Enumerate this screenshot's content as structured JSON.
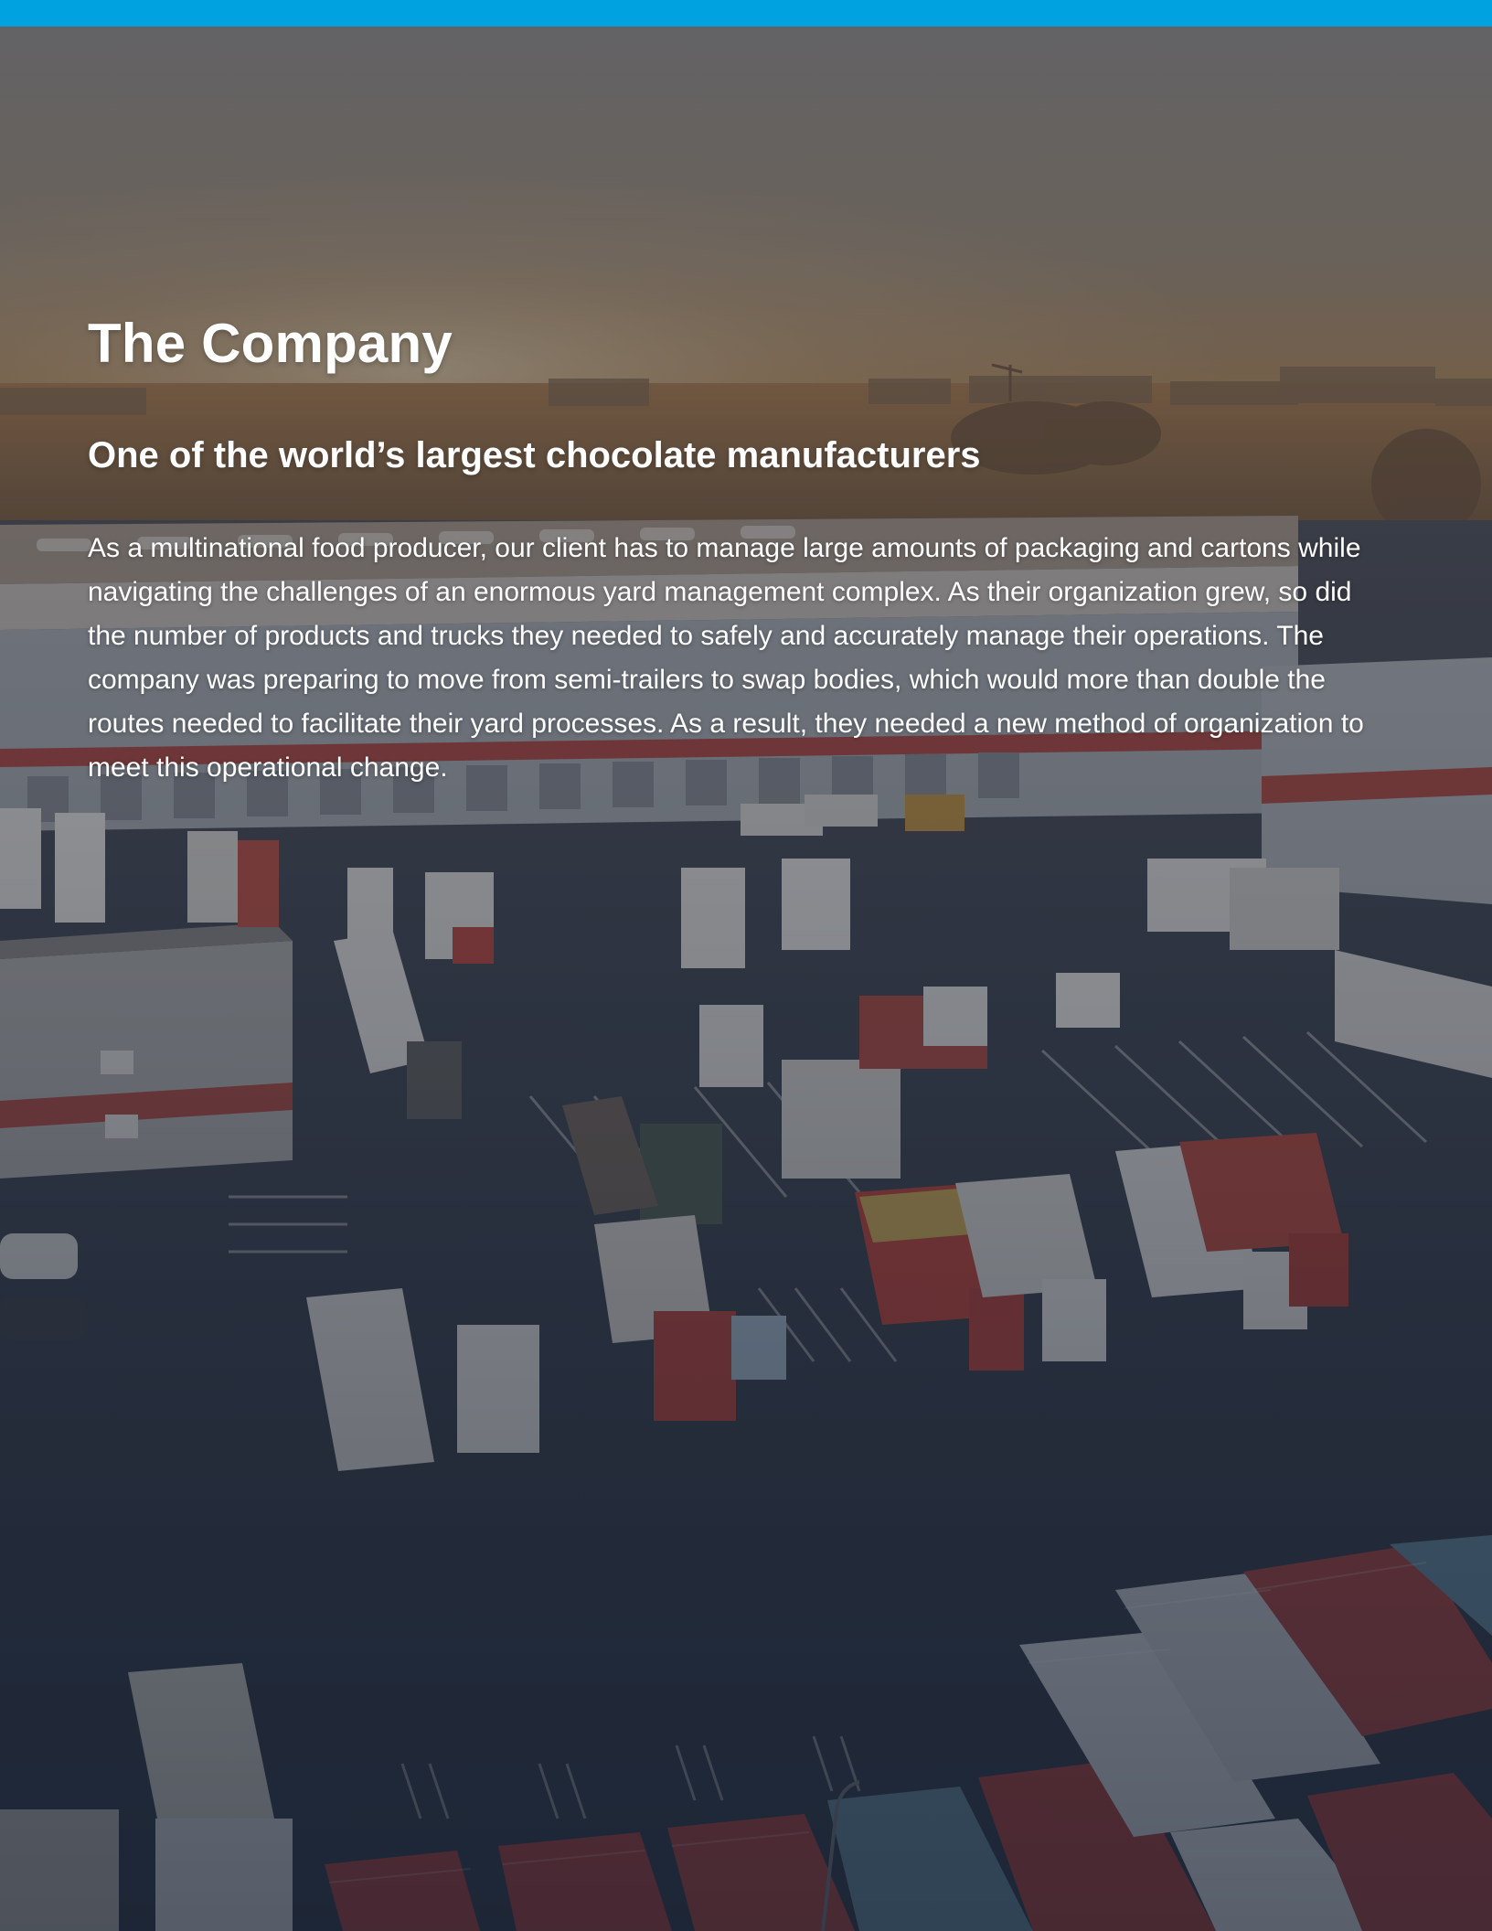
{
  "header_bar": {
    "color": "#00a3e0"
  },
  "hero_image": {
    "subject": "aerial-truck-yard-at-sunset",
    "overlay_color": "#1b2536"
  },
  "section": {
    "title": "The Company",
    "subtitle": "One of the world’s largest chocolate manufacturers",
    "body": "As a multinational food producer, our client has to manage large amounts of packaging and cartons while navigating the challenges of an enormous yard management complex. As their organization grew, so did the number of products and trucks they needed to safely and accurately manage their operations. The company was preparing to move from semi-trailers to swap bodies, which would more than double the routes needed to facilitate their yard processes. As a result, they needed a new method of organization to meet this operational change."
  }
}
